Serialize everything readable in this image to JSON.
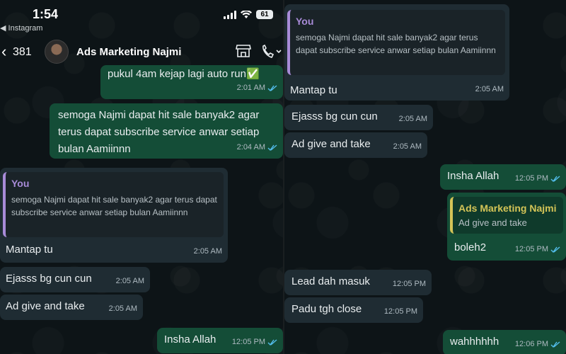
{
  "status": {
    "time": "1:54",
    "source": "◀ Instagram",
    "battery": "61"
  },
  "header": {
    "back": "‹",
    "unread_count": "381",
    "contact_name": "Ads Marketing Najmi"
  },
  "left": {
    "m1": {
      "text": "pukul 4am kejap lagi auto run✅",
      "time": "2:01 AM"
    },
    "m2": {
      "text": "semoga Najmi dapat hit sale banyak2 agar terus dapat subscribe service anwar setiap bulan Aamiinnn",
      "time": "2:04 AM"
    },
    "m3": {
      "quote_title": "You",
      "quote_text": "semoga Najmi dapat hit sale banyak2 agar terus dapat subscribe service anwar setiap bulan Aamiinnn",
      "text": "Mantap tu",
      "time": "2:05 AM"
    },
    "m4": {
      "text": "Ejasss bg cun cun",
      "time": "2:05 AM"
    },
    "m5": {
      "text": "Ad give and take",
      "time": "2:05 AM"
    },
    "m6": {
      "text": "Insha Allah",
      "time": "12:05 PM"
    }
  },
  "right": {
    "m1": {
      "quote_title": "You",
      "quote_text": "semoga Najmi dapat hit sale banyak2 agar terus dapat subscribe service anwar setiap bulan Aamiinnn",
      "text": "Mantap tu",
      "time": "2:05 AM"
    },
    "m2": {
      "text": "Ejasss bg cun cun",
      "time": "2:05 AM"
    },
    "m3": {
      "text": "Ad give and take",
      "time": "2:05 AM"
    },
    "m4": {
      "text": "Insha Allah",
      "time": "12:05 PM"
    },
    "m5": {
      "quote_title": "Ads Marketing Najmi",
      "quote_text": "Ad give and take",
      "text": "boleh2",
      "time": "12:05 PM"
    },
    "m6": {
      "text": "Lead dah masuk",
      "time": "12:05 PM"
    },
    "m7": {
      "text": "Padu tgh close",
      "time": "12:05 PM"
    },
    "m8": {
      "text": "wahhhhhh",
      "time": "12:06 PM"
    }
  },
  "colors": {
    "outgoing": "#144d37",
    "incoming": "#1f2c33",
    "read_tick": "#53bdeb",
    "quote_you": "#a88bd8",
    "quote_contact": "#d4c457"
  }
}
